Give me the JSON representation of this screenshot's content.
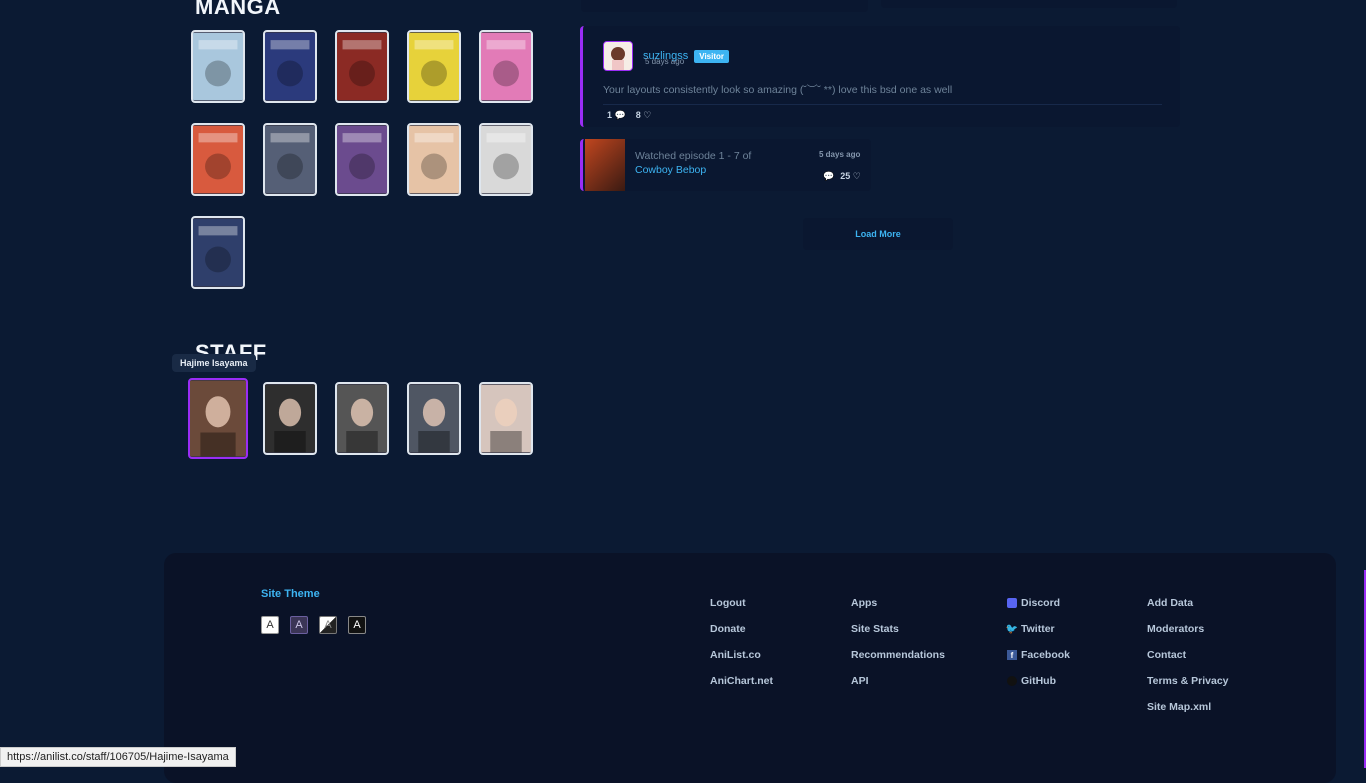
{
  "manga": {
    "title": "MANGA",
    "covers": [
      {
        "name": "manga-cover-1",
        "color": "#a9c7dd"
      },
      {
        "name": "manga-cover-2",
        "color": "#2b3a7c"
      },
      {
        "name": "manga-cover-3",
        "color": "#8b2a24"
      },
      {
        "name": "manga-cover-4",
        "color": "#e7d23a"
      },
      {
        "name": "manga-cover-5",
        "color": "#e27bb7"
      },
      {
        "name": "manga-cover-6",
        "color": "#d85a3e"
      },
      {
        "name": "manga-cover-7",
        "color": "#555f76"
      },
      {
        "name": "manga-cover-8",
        "color": "#6b4b8e"
      },
      {
        "name": "manga-cover-9",
        "color": "#e6c3a6"
      },
      {
        "name": "manga-cover-10",
        "color": "#d9d9d9"
      },
      {
        "name": "manga-cover-11",
        "color": "#2f3f6b"
      }
    ]
  },
  "staff": {
    "title": "STAFF",
    "tooltip": "Hajime Isayama",
    "members": [
      {
        "name": "Hajime Isayama",
        "color": "#6b4a3a"
      },
      {
        "name": "staff-2",
        "color": "#2e2e2e"
      },
      {
        "name": "staff-3",
        "color": "#555"
      },
      {
        "name": "staff-4",
        "color": "#4f5663"
      },
      {
        "name": "staff-5",
        "color": "#d6c5bd"
      }
    ]
  },
  "activity": {
    "comment": {
      "username": "suzlingss",
      "badge": "Visitor",
      "time": "5 days ago",
      "text": "Your layouts consistently look so amazing (˘︶˘ **) love this bsd one as well",
      "replies": "1",
      "likes": "8"
    },
    "watch": {
      "text": "Watched episode 1 - 7 of",
      "title": "Cowboy Bebop",
      "time": "5 days ago",
      "likes": "25"
    },
    "load_more": "Load More"
  },
  "footer": {
    "theme_title": "Site Theme",
    "themes": [
      "A",
      "A",
      "A",
      "A"
    ],
    "col1": [
      "Logout",
      "Donate",
      "AniList.co",
      "AniChart.net"
    ],
    "col2": [
      "Apps",
      "Site Stats",
      "Recommendations",
      "API"
    ],
    "col3": [
      "Discord",
      "Twitter",
      "Facebook",
      "GitHub"
    ],
    "col4": [
      "Add Data",
      "Moderators",
      "Contact",
      "Terms & Privacy",
      "Site Map.xml"
    ]
  },
  "statusbar": "https://anilist.co/staff/106705/Hajime-Isayama",
  "colors": {
    "bg": "#0b1a33",
    "accent": "#3db4f2",
    "purple": "#9a2df6"
  }
}
